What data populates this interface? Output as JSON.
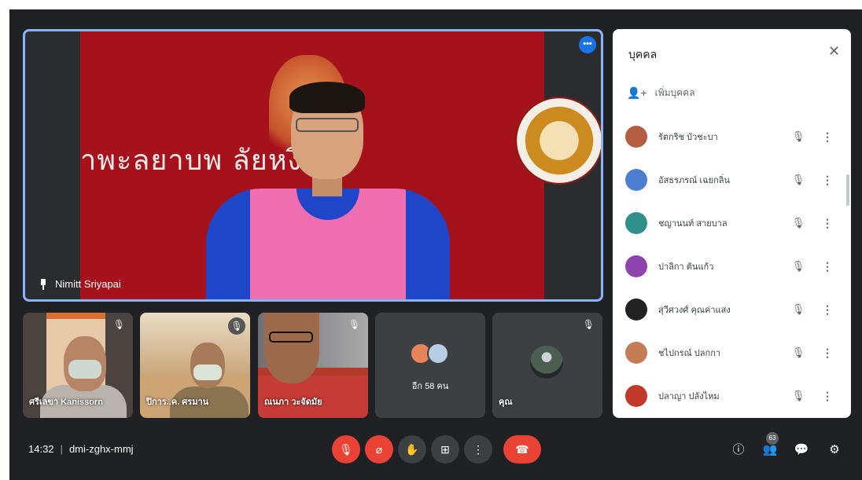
{
  "main_stage": {
    "speaker_name": "Nimitt Sriyapai",
    "banner_text": "าพะลยาบพ ลัยหงิ"
  },
  "tiles": [
    {
      "name": "ศรีเลขา Kanissorn",
      "muted": true
    },
    {
      "name": "ปิการ..ค. ศรมาน",
      "muted": true
    },
    {
      "name": "ณนภา วะจัดมัย",
      "muted": true
    },
    {
      "name": "",
      "label": "อีก 58 คน",
      "muted": false
    },
    {
      "name": "คุณ",
      "muted": true
    }
  ],
  "bottom_bar": {
    "time": "14:32",
    "separator": "|",
    "meeting_code": "dmi-zghx-mmj",
    "participant_count": "63"
  },
  "icons": {
    "mic_off": "🎙",
    "more_vert": "⋮",
    "more_horiz": "•••",
    "close": "✕",
    "add_person": "👤+",
    "hand": "✋",
    "present": "⊞",
    "end_call": "☎",
    "info": "ⓘ",
    "people": "👥",
    "chat": "💬",
    "activities": "⚙"
  },
  "people_panel": {
    "title": "บุคคล",
    "add_people_label": "เพิ่มบุคคล",
    "participants": [
      {
        "name": "รัตกริช บัวชะบา",
        "avatar_color": "#b55d43"
      },
      {
        "name": "อัสธรภรณ์ เฉยกลิ่น",
        "avatar_color": "#4d7fd1"
      },
      {
        "name": "ชญานนท์ สายบาล",
        "avatar_color": "#2e8f8b"
      },
      {
        "name": "ปาลิกา ต้นแก้ว",
        "avatar_color": "#8e44ad"
      },
      {
        "name": "สุวีศวงศ์ คุณค่าแสง",
        "avatar_color": "#222222"
      },
      {
        "name": "ชไปกรณ์ ปลกกา",
        "avatar_color": "#c47d57"
      },
      {
        "name": "ปลาญา ปลังไหม",
        "avatar_color": "#c0392b"
      }
    ]
  }
}
